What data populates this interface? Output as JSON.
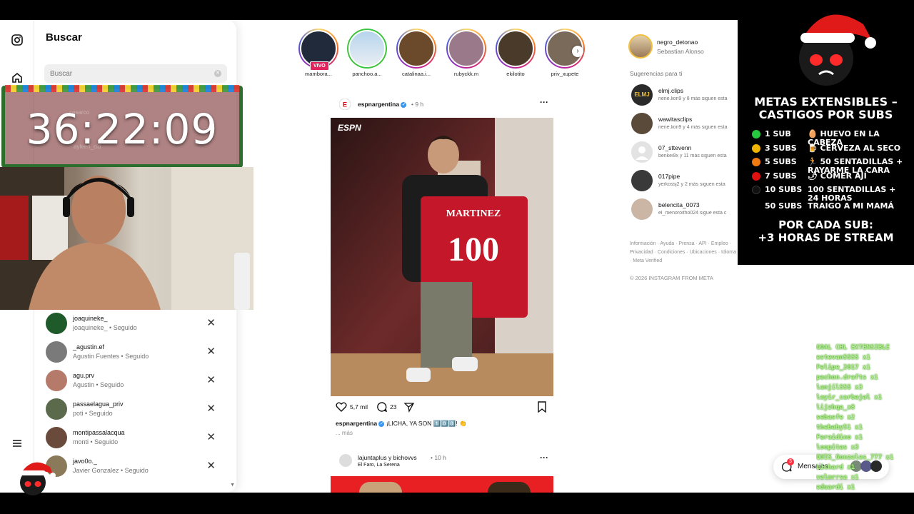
{
  "search": {
    "title": "Buscar",
    "placeholder": "Buscar",
    "recent": [
      {
        "user": "joaquineke_",
        "sub": "joaquineke_ • Seguido",
        "color": "#1f5a2a"
      },
      {
        "user": "_agustin.ef",
        "sub": "Agustin Fuentes • Seguido",
        "color": "#7a7a7a"
      },
      {
        "user": "agu.prv",
        "sub": "Agustin • Seguido",
        "color": "#b57a6a"
      },
      {
        "user": "passaelagua_priv",
        "sub": "poti • Seguido",
        "color": "#5a6a4a"
      },
      {
        "user": "montipassalacqua",
        "sub": "monti • Seguido",
        "color": "#6a4a3a"
      },
      {
        "user": "javo0o._",
        "sub": "Javier Gonzalez • Seguido",
        "color": "#8a7a5a"
      }
    ],
    "hidden_rows": [
      {
        "user": "cesarco",
        "sub": ""
      },
      {
        "user": "ayleen_cid",
        "sub": ""
      }
    ],
    "partial_row": "...."
  },
  "stories": [
    {
      "name": "mambora...",
      "live": true,
      "live_label": "VIVO",
      "color": "#202a3a"
    },
    {
      "name": "panchoo.a...",
      "live": false,
      "color": "#cfe3f2",
      "green": true
    },
    {
      "name": "catalinaa.i...",
      "live": false,
      "color": "#6a4a2a"
    },
    {
      "name": "rubyckk.m",
      "live": false,
      "color": "#9a7a8a"
    },
    {
      "name": "ekilotito",
      "live": false,
      "color": "#4a3a2a"
    },
    {
      "name": "priv_xupete",
      "live": false,
      "color": "#7a6a5a"
    }
  ],
  "post": {
    "user": "espnargentina",
    "time": "• 9 h",
    "brand": "ESPN",
    "shirt_name": "MARTINEZ",
    "shirt_number": "100",
    "likes": "5,7 mil",
    "comments": "23",
    "caption_user": "espnargentina",
    "caption_text": "¡LICHA, YA SON 1️⃣0️⃣0️⃣! 👏",
    "more": "... más"
  },
  "post2": {
    "user": "lajuntaplus y bichovvs",
    "time": "• 10 h",
    "location": "El Faro, La Serena"
  },
  "profile": {
    "user": "negro_detonao",
    "name": "Sebastian Alonso"
  },
  "suggestions": {
    "title": "Sugerencias para ti",
    "items": [
      {
        "user": "elmj.clips",
        "sub": "nene.lion9 y 8 más siguen esta",
        "color": "#2a2a2a",
        "text": "ELMJ"
      },
      {
        "user": "wawitasclips",
        "sub": "nene.lion9 y 4 más siguen esta",
        "color": "#5a4a3a",
        "text": ""
      },
      {
        "user": "07_sttevenn",
        "sub": "benkei9x y 11 más siguen esta",
        "color": "#d9d9d9",
        "text": ""
      },
      {
        "user": "017pipe",
        "sub": "yerkossj2 y 2 más siguen esta",
        "color": "#3a3a3a",
        "text": ""
      },
      {
        "user": "belencita_0073",
        "sub": "el_menoroitho024 sigue esta c",
        "color": "#cbb6a6",
        "text": ""
      }
    ]
  },
  "footer": {
    "links": "Información · Ayuda · Prensa · API · Empleo · Privacidad · Condiciones · Ubicaciones · Idioma · Meta Verified",
    "copyright": "© 2026 INSTAGRAM FROM META"
  },
  "messages": {
    "label": "Mensajes",
    "badge": "3"
  },
  "timer": {
    "value": "36:22:09"
  },
  "goals": {
    "title_line1": "METAS EXTENSIBLES –",
    "title_line2": "CASTIGOS POR SUBS",
    "items": [
      {
        "subs": "1 SUB",
        "reward": "🥚 HUEVO EN LA CABEZA",
        "color": "#27c93f"
      },
      {
        "subs": "3 SUBS",
        "reward": "🍺 CERVEZA AL SECO",
        "color": "#f0b400"
      },
      {
        "subs": "5 SUBS",
        "reward": "🏃 50 SENTADILLAS + RAYARME LA CARA",
        "color": "#f07a10"
      },
      {
        "subs": "7 SUBS",
        "reward": "🌶 COMER AJÍ",
        "color": "#e01010"
      },
      {
        "subs": "10 SUBS",
        "reward": "100 SENTADILLAS + 24 HORAS",
        "color": "#111111"
      },
      {
        "subs": "50 SUBS",
        "reward": "TRAIGO A MI MAMÁ",
        "color": ""
      }
    ],
    "per_sub_line1": "POR CADA SUB:",
    "per_sub_line2": "+3 HORAS DE STREAM"
  },
  "chat": [
    "GOAL CHL EXTENSIBLE",
    "estevanSSSS x1",
    "Pelipe_2017 x1",
    "pachon.drafts x1",
    "lanjilSSS x3",
    "layir_carbajal x1",
    "lijzhqa_x8",
    "sebasfe x2",
    "thebaby51 x1",
    "Faraidino x1",
    "loopitas x3",
    "QUIS_Gonzales_777 x1",
    "Lichard x1",
    "valmrrsa x1",
    "eduardi x1"
  ]
}
